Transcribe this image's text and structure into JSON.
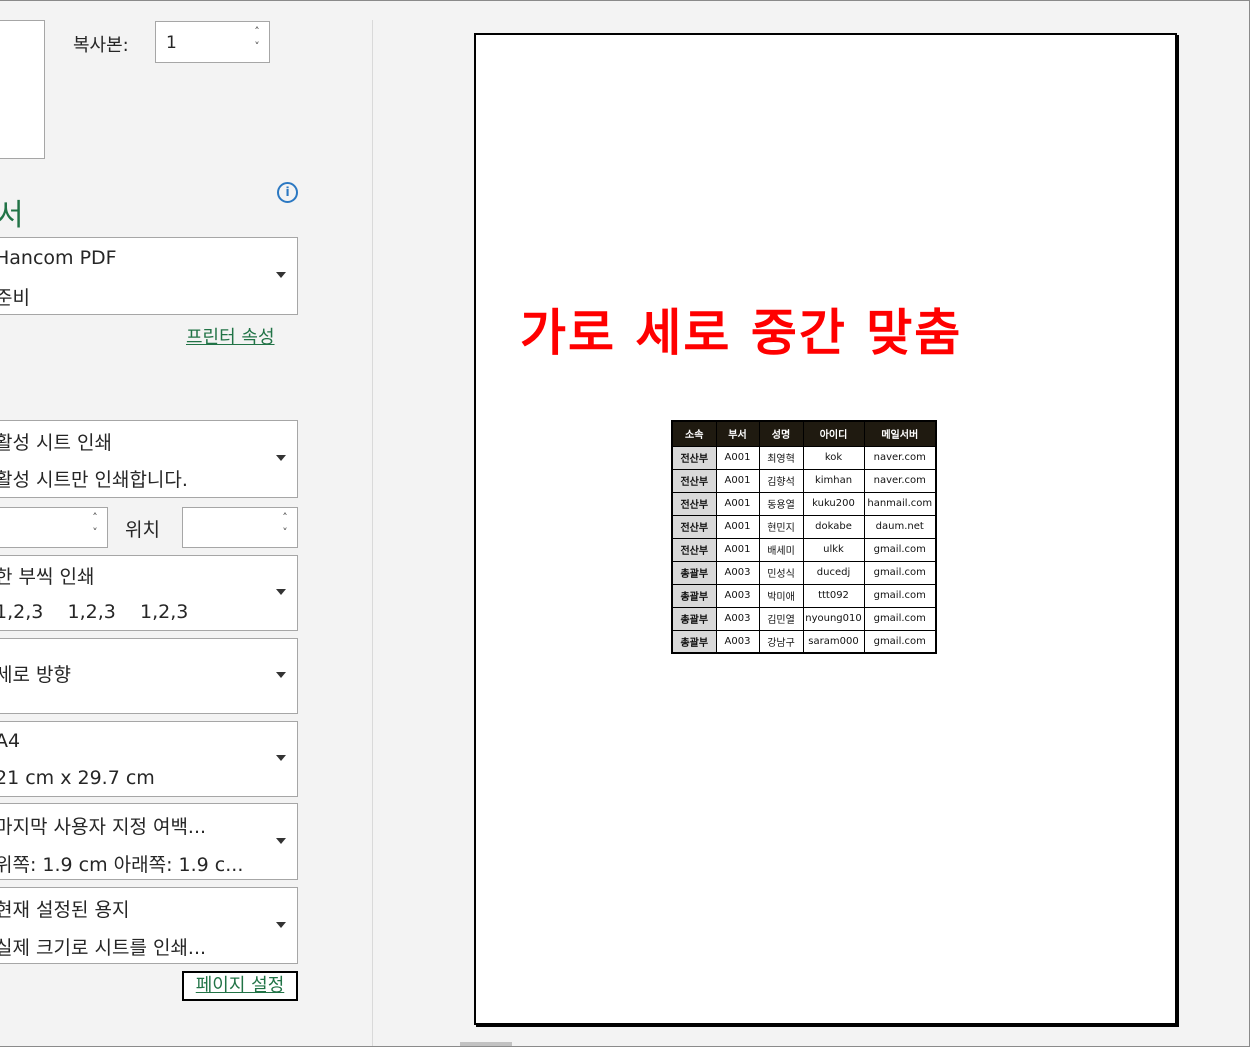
{
  "copies": {
    "label": "복사본:",
    "value": "1"
  },
  "section": {
    "title_fragment": "서"
  },
  "printer": {
    "name": "Hancom PDF",
    "status": "준비",
    "properties_link": "프린터 속성"
  },
  "settings": {
    "what_to_print": {
      "title": "활성 시트 인쇄",
      "desc": "활성 시트만 인쇄합니다."
    },
    "pages": {
      "from_value": "",
      "to_label": "위치",
      "to_value": ""
    },
    "collate": {
      "title": "한 부씩 인쇄",
      "desc": "1,2,3    1,2,3    1,2,3"
    },
    "orientation": {
      "title": "세로 방향"
    },
    "paper": {
      "title": "A4",
      "desc": "21 cm x 29.7 cm"
    },
    "margins": {
      "title": "마지막 사용자 지정 여백...",
      "desc": "위쪽: 1.9 cm 아래쪽: 1.9 c..."
    },
    "scaling": {
      "title": "현재 설정된 용지",
      "desc": "실제 크기로 시트를 인쇄..."
    },
    "page_setup_link": "페이지 설정"
  },
  "preview": {
    "headline": "가로 세로 중간 맞춤",
    "table": {
      "headers": [
        "소속",
        "부서",
        "성명",
        "아이디",
        "메일서버"
      ],
      "rows": [
        [
          "전산부",
          "A001",
          "최영혁",
          "kok",
          "naver.com"
        ],
        [
          "전산부",
          "A001",
          "김향석",
          "kimhan",
          "naver.com"
        ],
        [
          "전산부",
          "A001",
          "동용열",
          "kuku200",
          "hanmail.com"
        ],
        [
          "전산부",
          "A001",
          "현민지",
          "dokabe",
          "daum.net"
        ],
        [
          "전산부",
          "A001",
          "배세미",
          "ulkk",
          "gmail.com"
        ],
        [
          "총괄부",
          "A003",
          "민성식",
          "ducedj",
          "gmail.com"
        ],
        [
          "총괄부",
          "A003",
          "박미애",
          "ttt092",
          "gmail.com"
        ],
        [
          "총괄부",
          "A003",
          "김민열",
          "nyoung010",
          "gmail.com"
        ],
        [
          "총괄부",
          "A003",
          "강남구",
          "saram000",
          "gmail.com"
        ]
      ]
    }
  },
  "icons": {
    "info": "info-icon",
    "dropdown": "chevron-down-icon",
    "spinner": "spin-arrows-icon"
  },
  "colors": {
    "accent": "#217346",
    "headline": "#ff0000",
    "info": "#2b78c2"
  }
}
